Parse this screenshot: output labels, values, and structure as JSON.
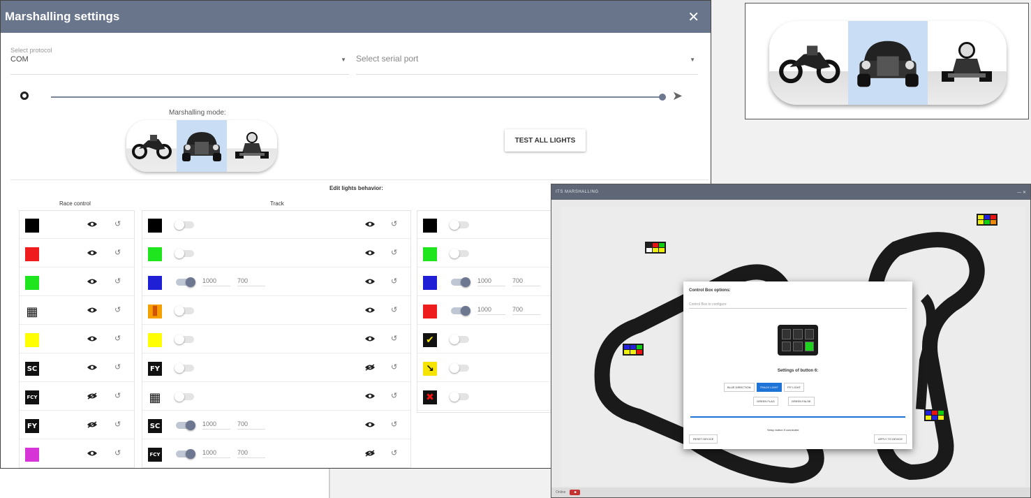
{
  "dialog": {
    "title": "Marshalling settings",
    "close_icon": "close-icon",
    "protocol": {
      "label": "Select protocol",
      "value": "COM"
    },
    "serial_port": {
      "placeholder": "Select serial port"
    },
    "mode_label": "Marshalling mode:",
    "modes": [
      "motorbike",
      "car",
      "kart"
    ],
    "selected_mode": "car",
    "test_button": "TEST ALL LIGHTS",
    "edit_title": "Edit lights behavior:",
    "race_control_label": "Race control",
    "track_label": "Track",
    "race_control_rows": [
      {
        "type": "color",
        "color": "#000000",
        "eye": "visible"
      },
      {
        "type": "color",
        "color": "#ee1c1c",
        "eye": "visible"
      },
      {
        "type": "color",
        "color": "#1fe51f",
        "eye": "visible"
      },
      {
        "type": "flag",
        "flag": "checkered",
        "eye": "visible"
      },
      {
        "type": "color",
        "color": "#ffff00",
        "eye": "visible"
      },
      {
        "type": "flag",
        "flag": "SC",
        "eye": "visible"
      },
      {
        "type": "flag",
        "flag": "FCY",
        "eye": "hidden"
      },
      {
        "type": "flag",
        "flag": "FY",
        "eye": "hidden"
      },
      {
        "type": "color",
        "color": "#d634d6",
        "eye": "visible"
      }
    ],
    "track_rows": [
      {
        "type": "color",
        "color": "#000000",
        "toggle": false,
        "eye": "visible"
      },
      {
        "type": "color",
        "color": "#1fe51f",
        "toggle": false,
        "eye": "visible"
      },
      {
        "type": "color",
        "color": "#1f1fd6",
        "toggle": true,
        "on": "1000",
        "off": "700",
        "eye": "visible"
      },
      {
        "type": "flag",
        "flag": "stripes",
        "toggle": false,
        "eye": "visible"
      },
      {
        "type": "color",
        "color": "#ffff00",
        "toggle": false,
        "eye": "visible"
      },
      {
        "type": "flag",
        "flag": "FY",
        "toggle": false,
        "eye": "hidden"
      },
      {
        "type": "flag",
        "flag": "checkered",
        "toggle": false,
        "eye": "visible"
      },
      {
        "type": "flag",
        "flag": "SC",
        "toggle": true,
        "on": "1000",
        "off": "700",
        "eye": "visible"
      },
      {
        "type": "flag",
        "flag": "FCY",
        "toggle": true,
        "on": "1000",
        "off": "700",
        "eye": "hidden"
      }
    ],
    "third_rows": [
      {
        "type": "color",
        "color": "#000000",
        "toggle": false
      },
      {
        "type": "color",
        "color": "#1fe51f",
        "toggle": false
      },
      {
        "type": "color",
        "color": "#1f1fd6",
        "toggle": true,
        "on": "1000",
        "off": "700"
      },
      {
        "type": "color",
        "color": "#ee1c1c",
        "toggle": true,
        "on": "1000",
        "off": "700"
      },
      {
        "type": "flag",
        "flag": "yellow-check",
        "toggle": false
      },
      {
        "type": "flag",
        "flag": "yellow-arrow",
        "toggle": false
      },
      {
        "type": "flag",
        "flag": "red-x",
        "toggle": false
      }
    ]
  },
  "app": {
    "title": "ITS MARSHALLING",
    "modal_title": "Control Box options:",
    "modal_select": "Control Box to configure",
    "button_title": "Settings of button 6:",
    "options": [
      "BLUE DIRECTION",
      "TRACK LIGHT",
      "PIT LIGHT"
    ],
    "selected_option": "TRACK LIGHT",
    "green_flag": "GREEN FLAG",
    "green_on": "GREEN FALSE",
    "checkbox": "Setup button if connected",
    "reset_button": "RESET DEVICE",
    "apply_button": "APPLY TO DEVICE",
    "footer_status": "Online"
  }
}
